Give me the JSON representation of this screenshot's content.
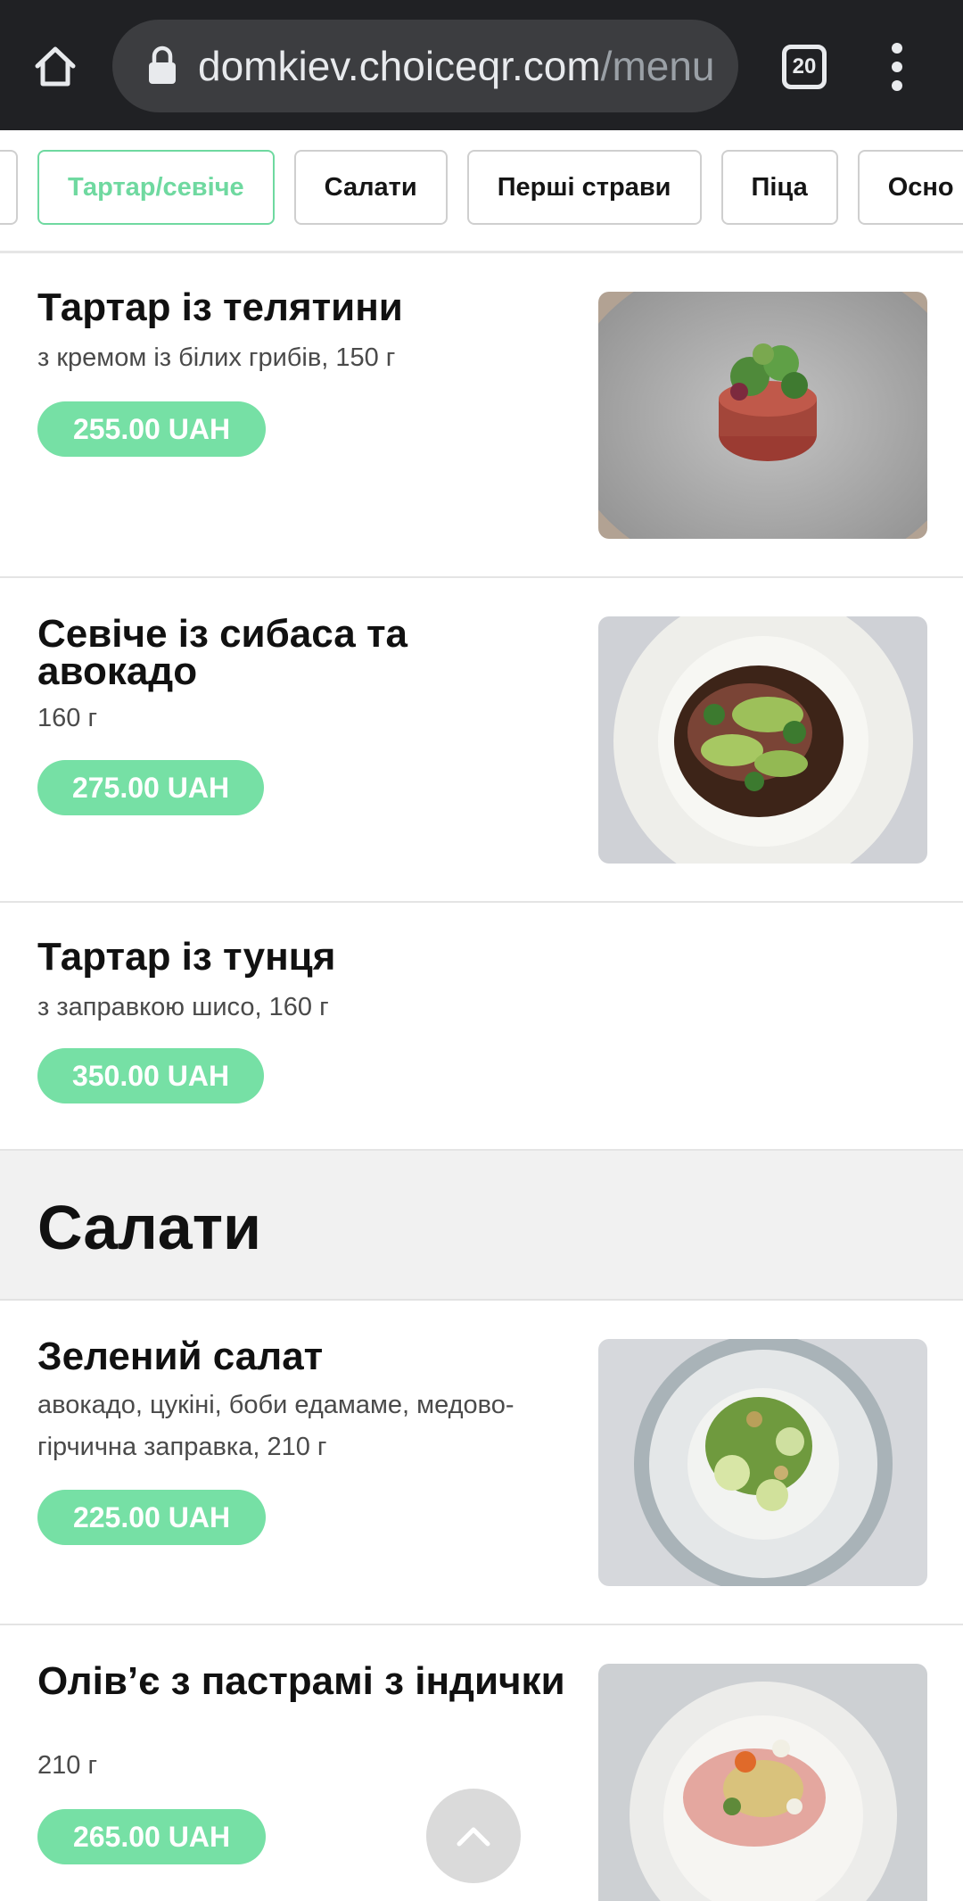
{
  "browser": {
    "url_host": "domkiev.choiceqr.com",
    "url_path": "/menu",
    "tab_count": "20",
    "icons": [
      "home-icon",
      "lock-icon",
      "tabs-icon",
      "more-vert-icon"
    ]
  },
  "categories": [
    {
      "label": "Тартар/севіче",
      "active": true
    },
    {
      "label": "Салати",
      "active": false
    },
    {
      "label": "Перші страви",
      "active": false
    },
    {
      "label": "Піца",
      "active": false
    },
    {
      "label": "Осно",
      "active": false
    }
  ],
  "items": [
    {
      "title": "Тартар із телятини",
      "desc": "з кремом із білих грибів, 150 г",
      "price": "255.00 UAH"
    },
    {
      "title": "Севіче із сибаса та авокадо",
      "desc": "160 г",
      "price": "275.00 UAH"
    },
    {
      "title": "Тартар із тунця",
      "desc": "з заправкою шисо, 160 г",
      "price": "350.00 UAH"
    }
  ],
  "section": {
    "title": "Салати"
  },
  "salads": [
    {
      "title": "Зелений салат",
      "desc": "авокадо, цукіні, боби едамаме, медово-гірчична заправка, 210 г",
      "price": "225.00 UAH"
    },
    {
      "title": "Олів’є з пастрамі з індички",
      "desc": "210 г",
      "price": "265.00 UAH"
    }
  ],
  "colors": {
    "accent": "#76e0a5",
    "accent_text": "#6fd9a0",
    "chrome": "#202124",
    "section_bg": "#f1f1f1"
  },
  "scroll_top": {
    "icon": "chevron-up-icon"
  }
}
